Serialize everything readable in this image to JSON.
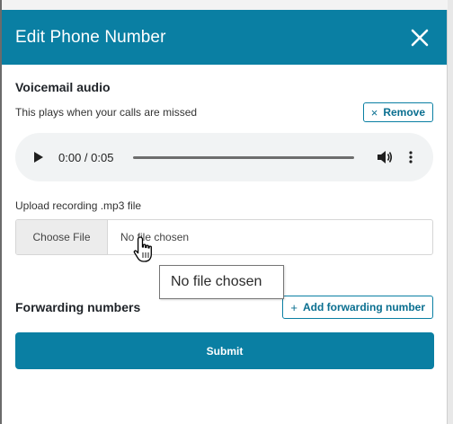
{
  "modal": {
    "title": "Edit Phone Number",
    "close_icon": "close-icon"
  },
  "voicemail": {
    "title": "Voicemail audio",
    "hint": "This plays when your calls are missed",
    "remove_label": "Remove",
    "remove_icon": "×"
  },
  "audio": {
    "time": "0:00 / 0:05",
    "progress": 0
  },
  "upload": {
    "label": "Upload recording .mp3 file",
    "button_label": "Choose File",
    "status": "No file chosen"
  },
  "tooltip": {
    "text": "No file chosen"
  },
  "forwarding": {
    "title": "Forwarding numbers",
    "add_label": "Add forwarding number",
    "add_icon": "+"
  },
  "submit": {
    "label": "Submit"
  },
  "colors": {
    "header": "#0a7fa3",
    "accent": "#0a7fa3",
    "audio_bg": "#f1f3f4"
  }
}
